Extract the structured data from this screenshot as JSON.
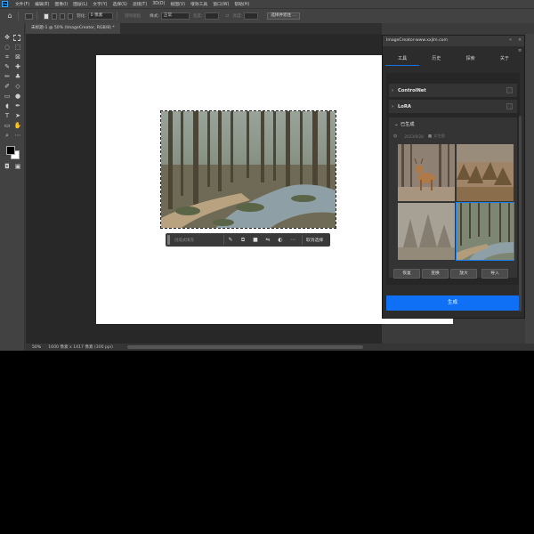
{
  "app": {
    "logo": "Ps",
    "menu": [
      "文件(F)",
      "编辑(E)",
      "图像(I)",
      "图层(L)",
      "文字(Y)",
      "选择(S)",
      "滤镜(T)",
      "3D(D)",
      "视图(V)",
      "增效工具",
      "窗口(W)",
      "帮助(H)"
    ]
  },
  "options_bar": {
    "feather_label": "羽化:",
    "feather_value": "0 像素",
    "antialias_label": "消除锯齿",
    "style_label": "样式:",
    "style_value": "正常",
    "width_label": "宽度:",
    "height_label": "高度:",
    "select_mask_button": "选择并遮住 ..."
  },
  "document": {
    "tab_label": "未标题-1 @ 50% (ImageCreator, RGB/8) *",
    "zoom": "50%",
    "info": "1600 像素 x 1417 像素 (300 ppi)"
  },
  "context_bar": {
    "prompt_placeholder": "创成式填充",
    "cancel_label": "取消选择",
    "icons": [
      "brush-icon",
      "transform-icon",
      "square-icon",
      "flip-icon",
      "contrast-icon",
      "more-icon"
    ]
  },
  "panel": {
    "title": "ImageCreator-www.xxjlm.com",
    "tabs": [
      "工具",
      "历史",
      "探索",
      "关于"
    ],
    "active_tab": "工具",
    "sections": {
      "controlnet": "ControlNet",
      "lora": "LoRA",
      "generated": "已生成"
    },
    "meta": {
      "date": "2023/9/28",
      "source": "文生图"
    },
    "thumbnails": [
      {
        "name": "deer-in-forest"
      },
      {
        "name": "autumn-landscape"
      },
      {
        "name": "misty-forest"
      },
      {
        "name": "forest-stream"
      }
    ],
    "actions": [
      "恢复",
      "变换",
      "放大",
      "导入"
    ],
    "generate_label": "生成"
  },
  "colors": {
    "accent": "#0f6ff5",
    "panel_bg": "#2c2c2c",
    "app_bg": "#3b3b3b"
  }
}
